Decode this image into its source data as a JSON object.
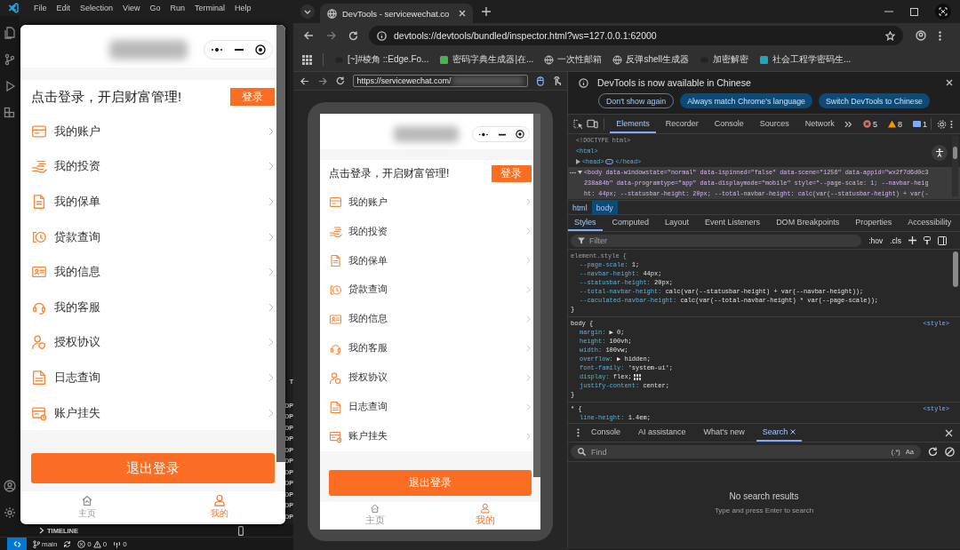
{
  "vscode": {
    "menu": [
      "File",
      "Edit",
      "Selection",
      "View",
      "Go",
      "Run",
      "Terminal",
      "Help"
    ],
    "panel_fragments": [
      "T",
      "DP",
      "DP",
      "DP",
      "DP",
      "DP",
      "DP",
      "DP",
      "DP",
      "DP",
      "DP",
      "DP"
    ],
    "timeline": {
      "label": "TIMELINE",
      "expanded": false
    },
    "status_bar": {
      "branch": "main",
      "errors": "0",
      "warnings": "0",
      "ports": "0"
    }
  },
  "simulator_window": {
    "phone": {
      "banner": "点击登录，开启财富管理!",
      "login_button": "登录",
      "items": [
        {
          "label": "我的账户"
        },
        {
          "label": "我的投资"
        },
        {
          "label": "我的保单"
        },
        {
          "label": "贷款查询"
        },
        {
          "label": "我的信息"
        },
        {
          "label": "我的客服"
        },
        {
          "label": "授权协议"
        },
        {
          "label": "日志查询"
        },
        {
          "label": "账户挂失"
        }
      ],
      "logout_button": "退出登录",
      "tabs": [
        {
          "label": "主页",
          "selected": false
        },
        {
          "label": "我的",
          "selected": true
        }
      ]
    }
  },
  "browser": {
    "tab": {
      "title": "DevTools - servicewechat.co"
    },
    "address": "devtools://devtools/bundled/inspector.html?ws=127.0.0.1:62000",
    "bookmarks": [
      {
        "label": "[~]#棱角 ::Edge.Fo..."
      },
      {
        "label": "密码字典生成器|在..."
      },
      {
        "label": "一次性邮箱"
      },
      {
        "label": "反弹shell生成器"
      },
      {
        "label": "加密解密"
      },
      {
        "label": "社会工程学密码生..."
      }
    ]
  },
  "simulator_pane": {
    "url": "https://servicewechat.com/",
    "phone": {
      "banner": "点击登录，开启财富管理!",
      "login_button": "登录",
      "items": [
        {
          "label": "我的账户"
        },
        {
          "label": "我的投资"
        },
        {
          "label": "我的保单"
        },
        {
          "label": "贷款查询"
        },
        {
          "label": "我的信息"
        },
        {
          "label": "我的客服"
        },
        {
          "label": "授权协议"
        },
        {
          "label": "日志查询"
        },
        {
          "label": "账户挂失"
        }
      ],
      "logout_button": "退出登录",
      "tabs": [
        {
          "label": "主页",
          "selected": false
        },
        {
          "label": "我的",
          "selected": true
        }
      ]
    }
  },
  "devtools": {
    "notice": {
      "text": "DevTools is now available in Chinese",
      "buttons": [
        {
          "label": "Don't show again",
          "kind": "outline"
        },
        {
          "label": "Always match Chrome's language",
          "kind": "filled"
        },
        {
          "label": "Switch DevTools to Chinese",
          "kind": "filled"
        }
      ]
    },
    "panel_tabs": [
      {
        "label": "Elements",
        "selected": true
      },
      {
        "label": "Recorder",
        "selected": false
      },
      {
        "label": "Console",
        "selected": false
      },
      {
        "label": "Sources",
        "selected": false
      },
      {
        "label": "Network",
        "selected": false
      }
    ],
    "issue_counts": {
      "errors": "5",
      "warnings": "8",
      "messages": "1"
    },
    "dom_lines": [
      {
        "kind": "plain",
        "text": "<!DOCTYPE html>"
      },
      {
        "kind": "plain",
        "text": "<html>"
      },
      {
        "kind": "collapsed",
        "open": "<head>",
        "close": "</head>"
      },
      {
        "kind": "selected",
        "lines": [
          "<body data-windowstate=\"normal\" data-ispinned=\"false\" data-scene=\"1256\" data-appid=\"wx2f7d6d0c3",
          "238a84b\" data-programtype=\"app\" data-displaymode=\"mobile\" style=\"--page-scale: 1; --navbar-heig",
          "ht: 44px; --statusbar-height: 20px; --total-navbar-height: calc(var(--statusbar-height) + var(-"
        ]
      }
    ],
    "breadcrumbs": [
      {
        "label": "html",
        "selected": false
      },
      {
        "label": "body",
        "selected": true
      }
    ],
    "style_tabs": [
      {
        "label": "Styles",
        "selected": true
      },
      {
        "label": "Computed",
        "selected": false
      },
      {
        "label": "Layout",
        "selected": false
      },
      {
        "label": "Event Listeners",
        "selected": false
      },
      {
        "label": "DOM Breakpoints",
        "selected": false
      },
      {
        "label": "Properties",
        "selected": false
      },
      {
        "label": "Accessibility",
        "selected": false
      }
    ],
    "filter": {
      "placeholder": "Filter",
      "toggles": [
        ":hov",
        ".cls"
      ]
    },
    "rules": [
      {
        "header": "element.style {",
        "declarations": [
          {
            "property": "--page-scale:",
            "value": "1;"
          },
          {
            "property": "--navbar-height:",
            "value": "44px;"
          },
          {
            "property": "--statusbar-height:",
            "value": "20px;"
          },
          {
            "property": "--total-navbar-height:",
            "value": "calc(var(--statusbar-height) + var(--navbar-height));"
          },
          {
            "property": "--caculated-navbar-height:",
            "value": "calc(var(--total-navbar-height) * var(--page-scale));"
          }
        ],
        "close": "}"
      },
      {
        "header": "body {",
        "source": "<style>",
        "declarations": [
          {
            "property": "margin:",
            "value": "▶ 0;"
          },
          {
            "property": "height:",
            "value": "100vh;"
          },
          {
            "property": "width:",
            "value": "100vw;"
          },
          {
            "property": "overflow:",
            "value": "▶ hidden;"
          },
          {
            "property": "font-family:",
            "value": "'system-ui';"
          },
          {
            "property": "display:",
            "value": "flex;",
            "editor": true
          },
          {
            "property": "justify-content:",
            "value": "center;"
          }
        ],
        "close": "}"
      },
      {
        "header": "* {",
        "source": "<style>",
        "declarations": [
          {
            "property": "line-height:",
            "value": "1.4em;"
          }
        ]
      }
    ],
    "drawer_tabs": [
      {
        "label": "Console",
        "selected": false,
        "closable": false
      },
      {
        "label": "AI assistance",
        "selected": false,
        "closable": false
      },
      {
        "label": "What's new",
        "selected": false,
        "closable": false
      },
      {
        "label": "Search",
        "selected": true,
        "closable": true
      }
    ],
    "search": {
      "placeholder": "Find",
      "options": [
        "(.*)",
        "Aa"
      ]
    },
    "empty_title": "No search results",
    "empty_hint": "Type and press Enter to search"
  }
}
